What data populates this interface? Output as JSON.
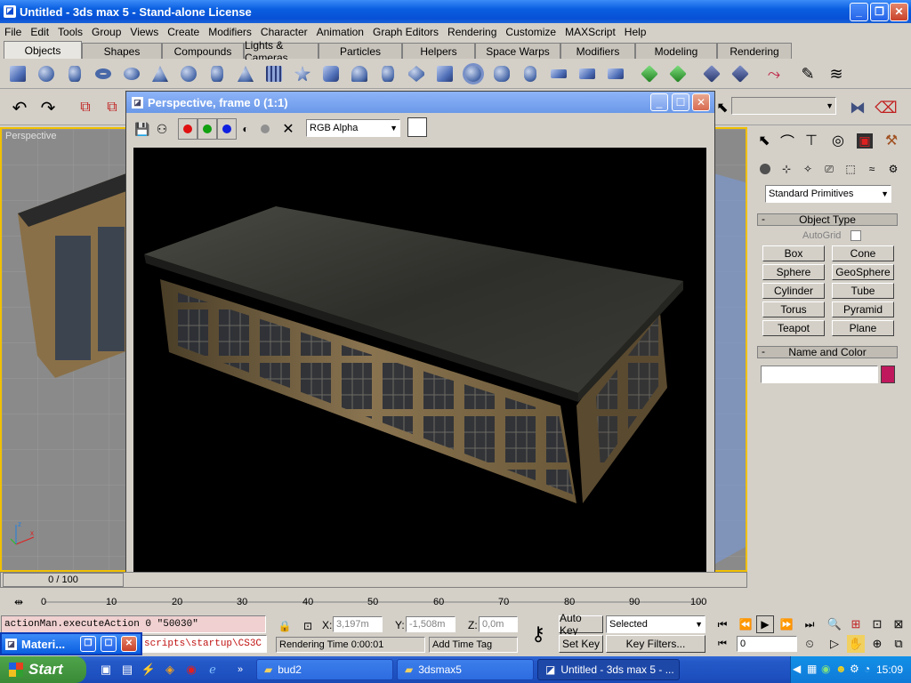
{
  "window": {
    "title": "Untitled - 3ds max 5 - Stand-alone License",
    "app_icon": "3ds-max-icon"
  },
  "menu": [
    "File",
    "Edit",
    "Tools",
    "Group",
    "Views",
    "Create",
    "Modifiers",
    "Character",
    "Animation",
    "Graph Editors",
    "Rendering",
    "Customize",
    "MAXScript",
    "Help"
  ],
  "tabs": [
    "Objects",
    "Shapes",
    "Compounds",
    "Lights & Cameras",
    "Particles",
    "Helpers",
    "Space Warps",
    "Modifiers",
    "Modeling",
    "Rendering"
  ],
  "viewport": {
    "label": "Perspective"
  },
  "render_window": {
    "title": "Perspective, frame 0 (1:1)",
    "channel": "RGB Alpha"
  },
  "command_panel": {
    "category": "Standard Primitives",
    "object_type_header": "Object Type",
    "autogrid": "AutoGrid",
    "buttons": [
      "Box",
      "Cone",
      "Sphere",
      "GeoSphere",
      "Cylinder",
      "Tube",
      "Torus",
      "Pyramid",
      "Teapot",
      "Plane"
    ],
    "name_color_header": "Name and Color",
    "color": "#c0185c"
  },
  "timeline": {
    "frame_display": "0 / 100",
    "ticks": [
      "0",
      "10",
      "20",
      "30",
      "40",
      "50",
      "60",
      "70",
      "80",
      "90",
      "100"
    ]
  },
  "status": {
    "maxscript_line1": "actionMan.executeAction 0 \"50030\"",
    "maxscript_line2": "scripts\\startup\\CS3C",
    "x_label": "X:",
    "x_value": "3,197m",
    "y_label": "Y:",
    "y_value": "-1,508m",
    "z_label": "Z:",
    "z_value": "0,0m",
    "rendering_time": "Rendering Time  0:00:01",
    "add_time_tag": "Add Time Tag",
    "auto_key": "Auto Key",
    "selected": "Selected",
    "set_key": "Set Key",
    "key_filters": "Key Filters...",
    "frame": "0"
  },
  "material_editor": {
    "title": "Materi..."
  },
  "taskbar": {
    "start": "Start",
    "tasks": [
      "bud2",
      "3dsmax5",
      "Untitled - 3ds max 5 - ..."
    ],
    "clock": "15:09"
  }
}
